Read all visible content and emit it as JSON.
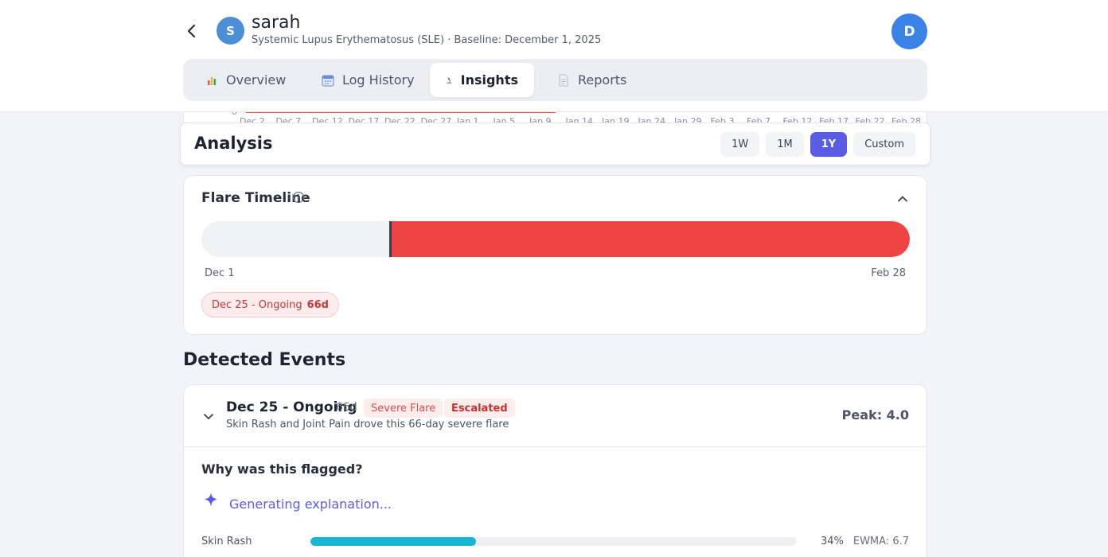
{
  "header": {
    "avatar_initial": "S",
    "patient_name": "sarah",
    "subtitle": "Systemic Lupus Erythematosus (SLE) · Baseline: December 1, 2025",
    "user_initial": "D"
  },
  "tabs": [
    {
      "label": "Overview",
      "icon": "chart-icon",
      "active": false
    },
    {
      "label": "Log History",
      "icon": "calendar-icon",
      "active": false
    },
    {
      "label": "Insights",
      "icon": "microscope-icon",
      "active": true
    },
    {
      "label": "Reports",
      "icon": "document-icon",
      "active": false
    }
  ],
  "chart_remnant": {
    "zero_label": "0",
    "ticks": [
      "Dec 2",
      "Dec 7",
      "Dec 12",
      "Dec 17",
      "Dec 22",
      "Dec 27",
      "Jan 1",
      "Jan 5",
      "Jan 9",
      "Jan 14",
      "Jan 19",
      "Jan 24",
      "Jan 29",
      "Feb 3",
      "Feb 7",
      "Feb 12",
      "Feb 17",
      "Feb 22",
      "Feb 28"
    ]
  },
  "analysis": {
    "title": "Analysis",
    "ranges": [
      {
        "label": "1W",
        "active": false
      },
      {
        "label": "1M",
        "active": false
      },
      {
        "label": "1Y",
        "active": true
      },
      {
        "label": "Custom",
        "active": false
      }
    ]
  },
  "flare_timeline": {
    "title": "Flare Timeline",
    "start_label": "Dec 1",
    "end_label": "Feb 28",
    "flare_fraction": 0.735,
    "chip_range": "Dec 25 - Ongoing",
    "chip_duration": "66d"
  },
  "detected_events": {
    "title": "Detected Events",
    "event": {
      "date_range": "Dec 25 - Ongoing",
      "duration": "66d",
      "severity_badge": "Severe Flare",
      "status_badge": "Escalated",
      "description": "Skin Rash and Joint Pain drove this 66-day severe flare",
      "peak": "Peak: 4.0",
      "why_title": "Why was this flagged?",
      "generating_text": "Generating explanation...",
      "metric": {
        "label": "Skin Rash",
        "percent_value": 34,
        "percent_text": "34%",
        "ewma": "EWMA: 6.7"
      }
    }
  },
  "colors": {
    "accent": "#5b5ce6",
    "flare_red": "#ef4444",
    "metric_cyan": "#1bb5d4"
  }
}
